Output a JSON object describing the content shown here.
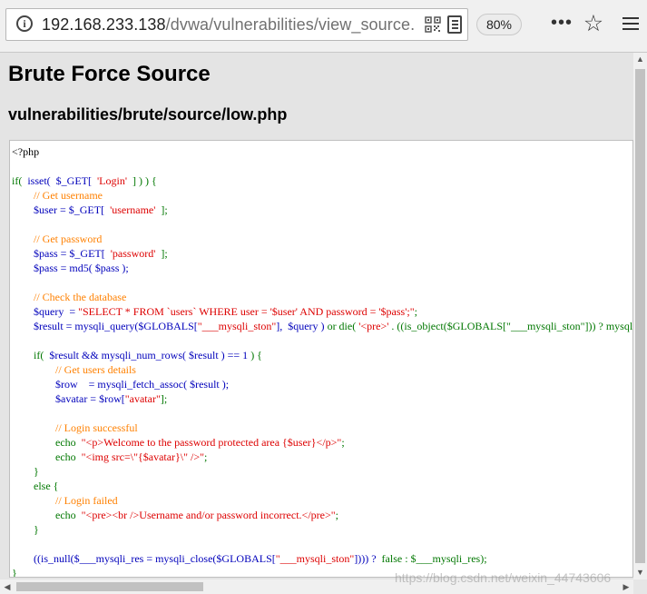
{
  "browser": {
    "url_host": "192.168.233.138",
    "url_path": "/dvwa/vulnerabilities/view_source.",
    "zoom": "80%",
    "icons": {
      "info": "info-icon",
      "qr": "qr-code-icon",
      "reader": "reader-view-icon",
      "more": "more-dots-icon",
      "bookmark": "star-icon",
      "menu": "hamburger-menu-icon"
    }
  },
  "page": {
    "title": "Brute Force Source",
    "file_path": "vulnerabilities/brute/source/low.php"
  },
  "code": {
    "line1": "<?php",
    "if_kw": "if(",
    "isset_call": "isset(",
    "get_login": "$_GET[",
    "login_key": "'Login'",
    "close_if": "] ) ) {",
    "c_get_username": "// Get username",
    "user_assign": "$user = $_GET[",
    "username_key": "'username'",
    "user_end": "];",
    "c_get_password": "// Get password",
    "pass_assign": "$pass = $_GET[",
    "password_key": "'password'",
    "pass_end": "];",
    "pass_md5": "$pass = md5( $pass );",
    "c_check_db": "// Check the database",
    "query_assign": "$query  = ",
    "query_str": "\"SELECT * FROM `users` WHERE user = '$user' AND password = '$pass';\"",
    "query_end": ";",
    "result_assign": "$result = mysqli_query($GLOBALS[",
    "ston_str": "\"___mysqli_ston\"",
    "result_mid": "],  $query ) ",
    "or_die": "or die(",
    "pre_str": "'<pre>'",
    "result_tail": " . ((is_object($GLOBALS[\"___mysqli_ston\"])) ? mysqli_error($GLOBALS[\"___mysqli_ston\"]) : (($___mysqli_res = mysqli_connect_error()) ? $___mysqli_res : false)) . '</pre>' );",
    "if_rows": "if(",
    "rows_cond": "$result && mysqli_num_rows( $result ) == 1 ",
    "rows_close": ") {",
    "c_get_details": "// Get users details",
    "row_assign": "$row    = mysqli_fetch_assoc( $result );",
    "avatar_assign": "$avatar = $row[",
    "avatar_key": "\"avatar\"",
    "avatar_end": "];",
    "c_login_ok": "// Login successful",
    "echo1_kw": "echo ",
    "echo1_str": "\"<p>Welcome to the password protected area {$user}</p>\"",
    "echo1_end": ";",
    "echo2_kw": "echo ",
    "echo2_str": "\"<img src=\\\"{$avatar}\\\" />\"",
    "echo2_end": ";",
    "brace1": "}",
    "else_kw": "else {",
    "c_login_fail": "// Login failed",
    "echo3_kw": "echo ",
    "echo3_str": "\"<pre><br />Username and/or password incorrect.</pre>\"",
    "echo3_end": ";",
    "brace2": "}",
    "close_line_a": "((is_null($___mysqli_res = mysqli_close($GLOBALS[",
    "close_line_ston": "\"___mysqli_ston\"",
    "close_line_b": "]))) ? ",
    "close_false": "false : $___mysqli_res);",
    "brace3": "}"
  },
  "watermark": "https://blog.csdn.net/weixin_44743606"
}
